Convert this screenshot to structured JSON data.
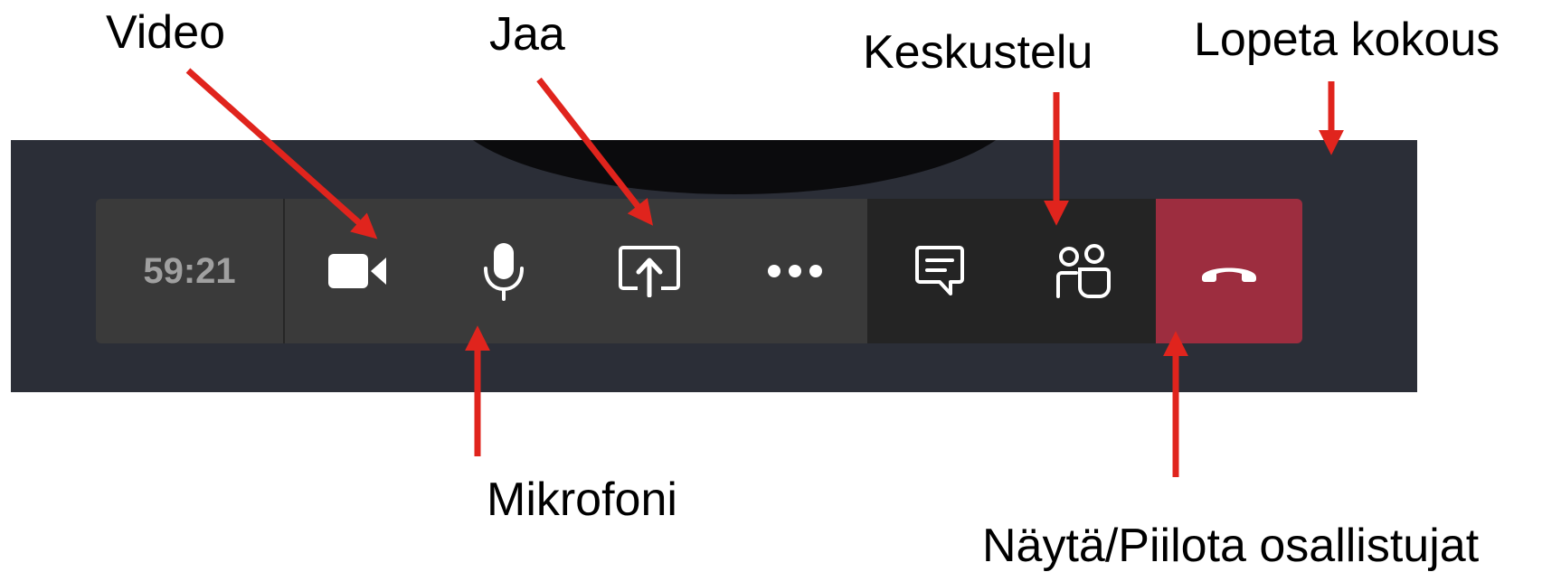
{
  "annotations": {
    "video": "Video",
    "share": "Jaa",
    "chat": "Keskustelu",
    "end_meeting": "Lopeta kokous",
    "microphone": "Mikrofoni",
    "participants": "Näytä/Piilota osallistujat"
  },
  "toolbar": {
    "timer": "59:21",
    "buttons": [
      {
        "name": "camera",
        "icon": "video-camera-icon"
      },
      {
        "name": "microphone",
        "icon": "microphone-icon"
      },
      {
        "name": "share",
        "icon": "share-screen-icon"
      },
      {
        "name": "more",
        "icon": "more-dots-icon"
      },
      {
        "name": "chat",
        "icon": "chat-icon"
      },
      {
        "name": "participants",
        "icon": "participants-icon"
      },
      {
        "name": "hang-up",
        "icon": "hang-up-icon"
      }
    ]
  },
  "colors": {
    "arrow": "#e0241d",
    "toolbar": "#3a3a3a",
    "toolbar_dark": "#242424",
    "hang_up": "#9d2d3f",
    "meeting_background": "#2b2e37"
  }
}
